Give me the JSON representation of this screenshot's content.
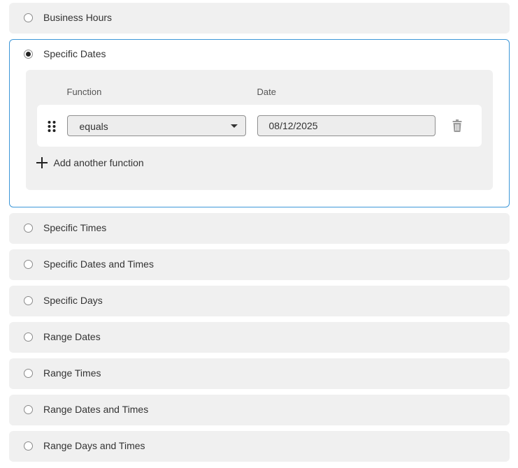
{
  "options": [
    {
      "label": "Business Hours",
      "selected": false
    },
    {
      "label": "Specific Dates",
      "selected": true
    },
    {
      "label": "Specific Times",
      "selected": false
    },
    {
      "label": "Specific Dates and Times",
      "selected": false
    },
    {
      "label": "Specific Days",
      "selected": false
    },
    {
      "label": "Range Dates",
      "selected": false
    },
    {
      "label": "Range Times",
      "selected": false
    },
    {
      "label": "Range Dates and Times",
      "selected": false
    },
    {
      "label": "Range Days and Times",
      "selected": false
    }
  ],
  "functions_panel": {
    "function_header": "Function",
    "date_header": "Date",
    "rows": [
      {
        "function": "equals",
        "date": "08/12/2025"
      }
    ],
    "add_label": "Add another function"
  },
  "colors": {
    "accent_border": "#3d97d8",
    "option_bg": "#f0f0f0"
  },
  "icons": {
    "drag": "drag-handle-icon",
    "dropdown": "chevron-down-icon",
    "delete": "trash-icon",
    "add": "plus-icon"
  }
}
